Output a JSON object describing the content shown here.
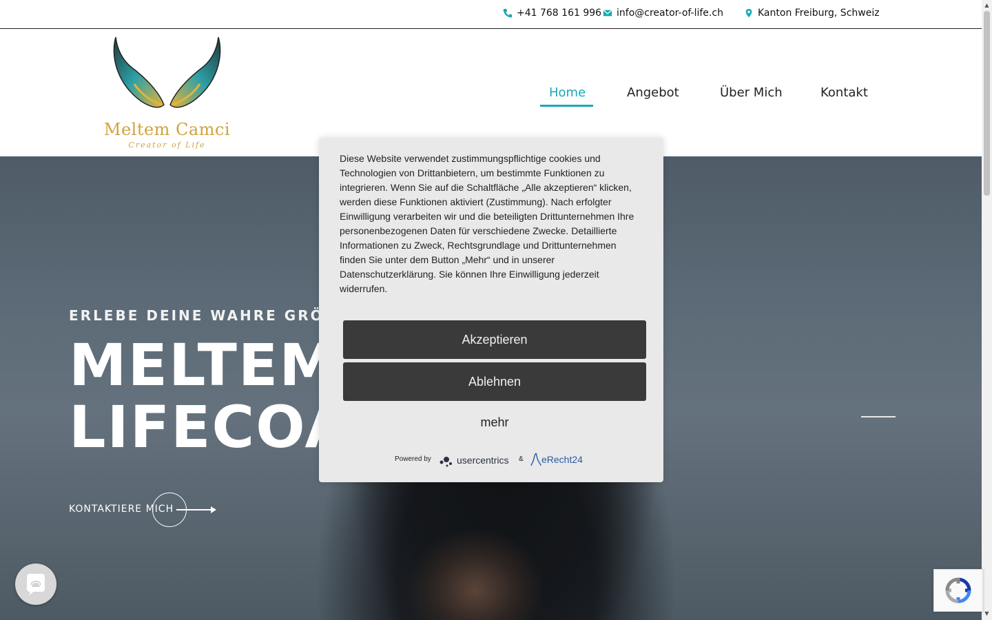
{
  "topbar": {
    "phone": "+41 768 161 996",
    "email": "info@creator-of-life.ch",
    "location": "Kanton Freiburg, Schweiz"
  },
  "logo": {
    "name": "Meltem Camci",
    "subtitle": "Creator of Life"
  },
  "nav": {
    "items": [
      "Home",
      "Angebot",
      "Über Mich",
      "Kontakt"
    ],
    "active": "Home"
  },
  "hero": {
    "tagline": "ERLEBE DEINE WAHRE GRÖSSE",
    "title_line1": "MELTEM",
    "title_line2": "LIFECOA",
    "cta": "KONTAKTIERE MICH"
  },
  "cookie": {
    "text": "Diese Website verwendet zustimmungspflichtige cookies und Technologien von Drittanbietern, um bestimmte Funktionen zu integrieren. Wenn Sie auf die Schaltfläche „Alle akzeptieren“ klicken, werden diese Funktionen aktiviert (Zustimmung). Nach erfolgter Einwilligung verarbeiten wir und die beteiligten Drittunternehmen Ihre personenbezogenen Daten für verschiedene Zwecke. Detaillierte Informationen zu Zweck, Rechtsgrundlage und Drittunternehmen finden Sie unter dem Button „Mehr“ und in unserer Datenschutzerklärung. Sie können Ihre Einwilligung jederzeit widerrufen.",
    "accept": "Akzeptieren",
    "decline": "Ablehnen",
    "more": "mehr",
    "powered_by": "Powered by",
    "usercentrics": "usercentrics",
    "amp": "&",
    "erecht": "eRecht24"
  },
  "colors": {
    "accent": "#16a9b3",
    "gold": "#cfa33a",
    "button_dark": "#3a3a3a",
    "modal_bg": "#e9e9e9"
  }
}
